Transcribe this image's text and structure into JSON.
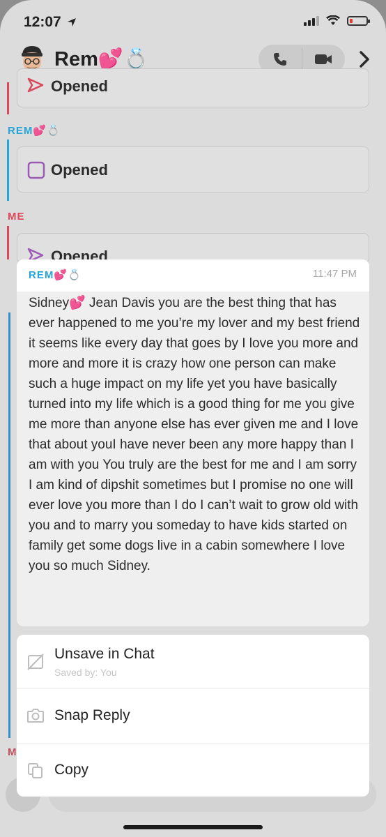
{
  "status_bar": {
    "time": "12:07"
  },
  "header": {
    "title": "Rem💕💍"
  },
  "chat": {
    "partial_top_label": "Opened",
    "rem_sender": "REM💕💍",
    "rem_status": "Opened",
    "me_sender": "ME",
    "me_status": "Opened",
    "bottom_sender_initial": "M"
  },
  "popup": {
    "sender": "REM💕💍",
    "time": "11:47 PM",
    "message": "Sidney💕 Jean Davis you are the best thing that has ever happened to me you’re my lover and my best friend it seems like every day that goes by I love you more and more and more it is crazy how one person can make such a huge impact on my life yet you have basically turned into my life which is a good thing for me you give me more than anyone else has ever given me and I love that about youI have never been any more happy than I am with you You truly are the best for me and I am sorry I am kind of dipshit sometimes but I promise no one will ever love you more than I do I can’t wait to grow old with you and to marry you someday to have kids started on family get some dogs live in a cabin somewhere I love you so much Sidney."
  },
  "menu": {
    "unsave_label": "Unsave in Chat",
    "saved_by": "Saved by: You",
    "snap_reply_label": "Snap Reply",
    "copy_label": "Copy"
  },
  "colors": {
    "rem_blue": "#27a4d8",
    "me_red": "#e0465a",
    "purple": "#9b59b6"
  }
}
